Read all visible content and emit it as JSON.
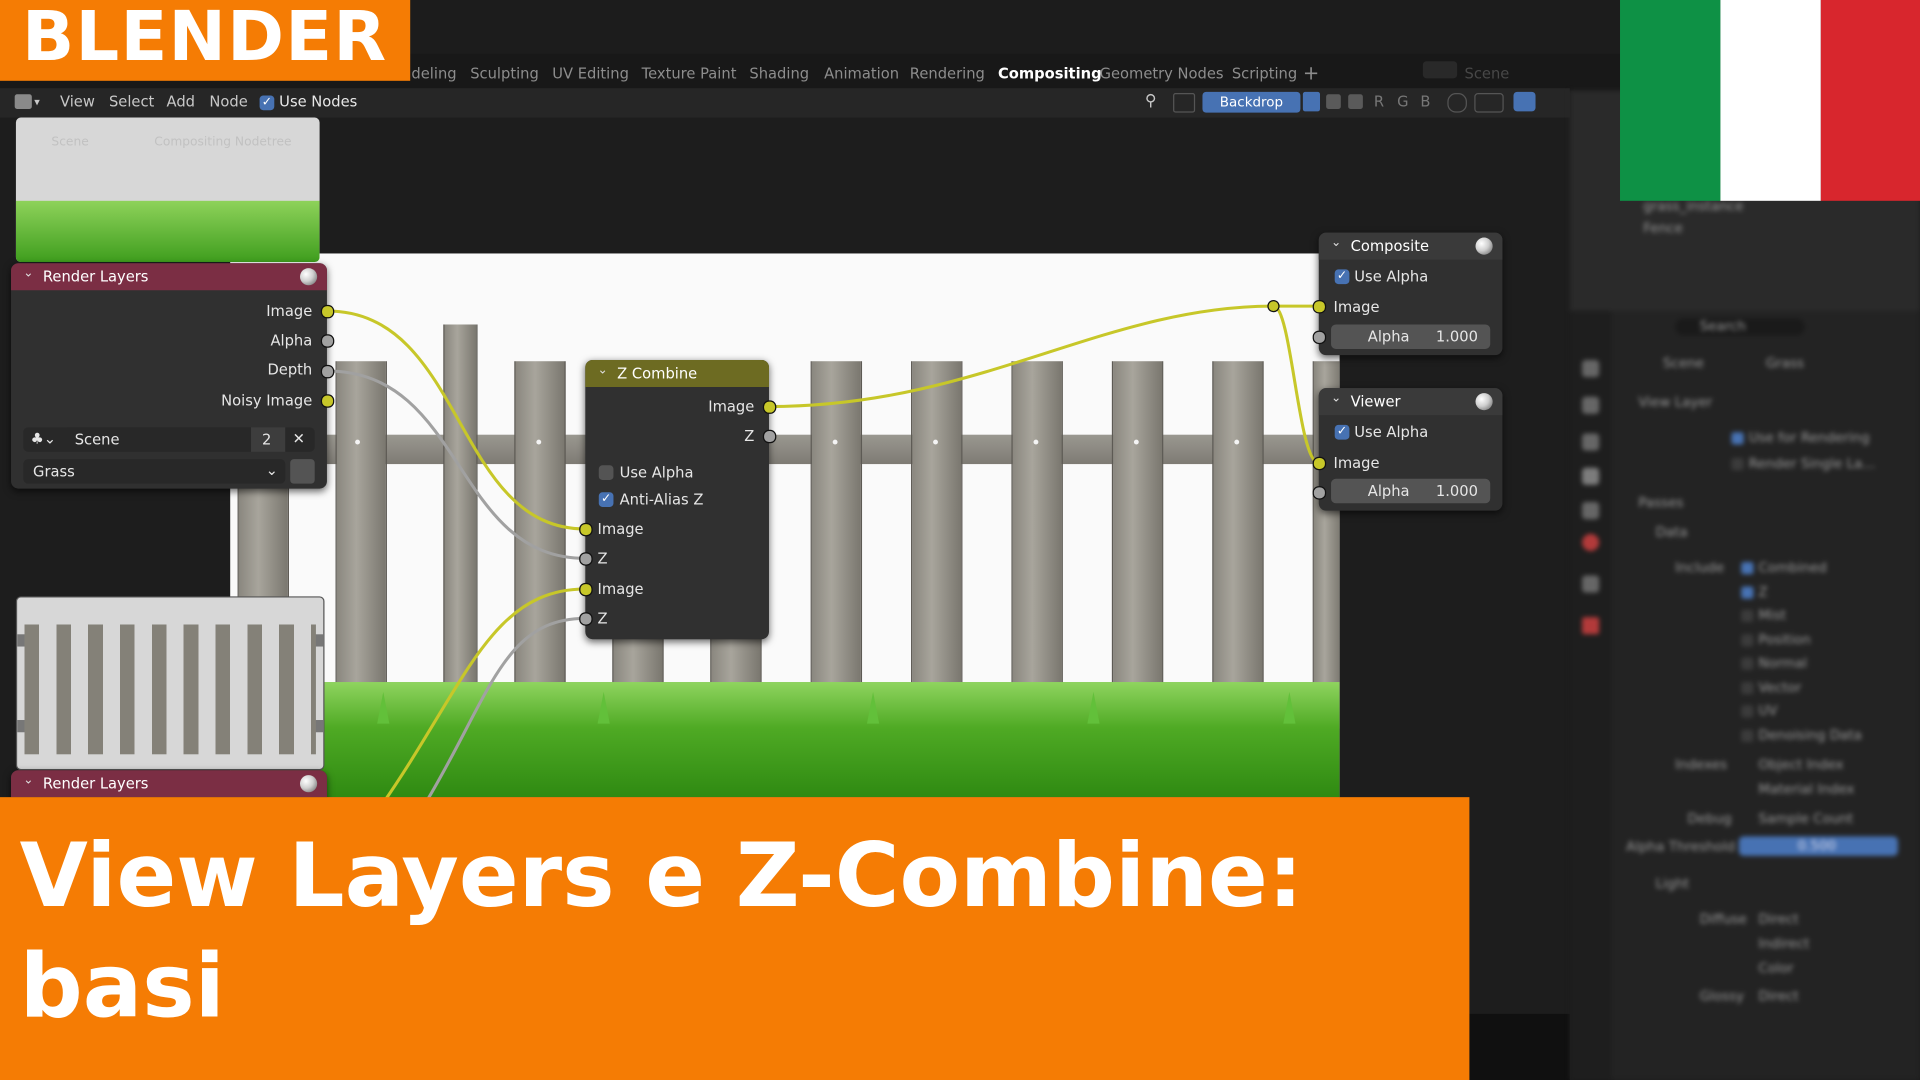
{
  "workspace_tabs": [
    "deling",
    "Sculpting",
    "UV Editing",
    "Texture Paint",
    "Shading",
    "Animation",
    "Rendering",
    "Compositing",
    "Geometry Nodes",
    "Scripting"
  ],
  "active_tab": "Compositing",
  "header": {
    "menus": [
      "View",
      "Select",
      "Add",
      "Node"
    ],
    "use_nodes_label": "Use Nodes",
    "backdrop_label": "Backdrop",
    "channels": [
      "R",
      "G",
      "B"
    ]
  },
  "breadcrumb": [
    "Scene",
    "Compositing Nodetree"
  ],
  "nodes": {
    "render_layers_1": {
      "title": "Render Layers",
      "outputs": [
        "Image",
        "Alpha",
        "Depth",
        "Noisy Image"
      ],
      "scene_value": "Scene",
      "scene_users": "2",
      "layer_value": "Grass"
    },
    "render_layers_2": {
      "title": "Render Layers"
    },
    "z_combine": {
      "title": "Z Combine",
      "outputs": [
        "Image",
        "Z"
      ],
      "use_alpha_label": "Use Alpha",
      "use_alpha_checked": false,
      "anti_alias_label": "Anti-Alias Z",
      "anti_alias_checked": true,
      "inputs": [
        "Image",
        "Z",
        "Image",
        "Z"
      ]
    },
    "composite": {
      "title": "Composite",
      "use_alpha_label": "Use Alpha",
      "input_image": "Image",
      "alpha_label": "Alpha",
      "alpha_value": "1.000"
    },
    "viewer": {
      "title": "Viewer",
      "use_alpha_label": "Use Alpha",
      "input_image": "Image",
      "alpha_label": "Alpha",
      "alpha_value": "1.000"
    }
  },
  "properties_panel": {
    "breadcrumb_scene": "Scene",
    "breadcrumb_layer": "Grass",
    "search_placeholder": "Search",
    "section_view_layer": "View Layer",
    "use_for_rendering": "Use for Rendering",
    "render_single_layer": "Render Single La...",
    "section_passes": "Passes",
    "section_data": "Data",
    "include_label": "Include",
    "include_items": [
      {
        "label": "Combined",
        "checked": true
      },
      {
        "label": "Z",
        "checked": true
      },
      {
        "label": "Mist",
        "checked": false
      },
      {
        "label": "Position",
        "checked": false
      },
      {
        "label": "Normal",
        "checked": false
      },
      {
        "label": "Vector",
        "checked": false
      },
      {
        "label": "UV",
        "checked": false
      },
      {
        "label": "Denoising Data",
        "checked": false
      }
    ],
    "indexes_label": "Indexes",
    "indexes_items": [
      "Object Index",
      "Material Index"
    ],
    "debug_label": "Debug",
    "debug_item": "Sample Count",
    "alpha_threshold_label": "Alpha Threshold",
    "alpha_threshold_value": "0.500",
    "section_light": "Light",
    "diffuse_label": "Diffuse",
    "diffuse_items": [
      "Direct",
      "Indirect",
      "Color"
    ],
    "glossy_label": "Glossy",
    "glossy_item": "Direct",
    "outliner_item_1": "grass_instance",
    "outliner_item_2": "Fence",
    "scene_label": "Scene"
  },
  "overlay": {
    "logo_text": "BLENDER",
    "title_line1": "View Layers e Z-Combine:",
    "title_line2": "basi",
    "flag_colors": [
      "#0e9145",
      "#ffffff",
      "#d8262d"
    ],
    "accent_color": "#f57c04"
  }
}
